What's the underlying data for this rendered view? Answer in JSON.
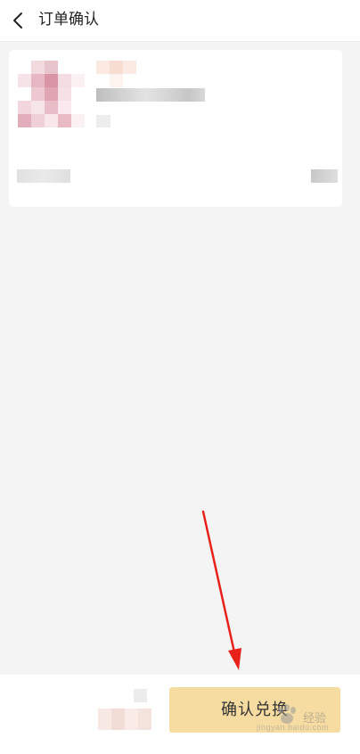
{
  "header": {
    "title": "订单确认",
    "back_icon": "chevron-left-icon"
  },
  "footer": {
    "confirm_label": "确认兑换"
  },
  "watermark": {
    "text": "经验",
    "site": "jingyan.baidu.com"
  },
  "colors": {
    "page_background": "#f4f4f4",
    "confirm_button": "#f6dca0",
    "annotation_arrow": "#e8211a"
  }
}
